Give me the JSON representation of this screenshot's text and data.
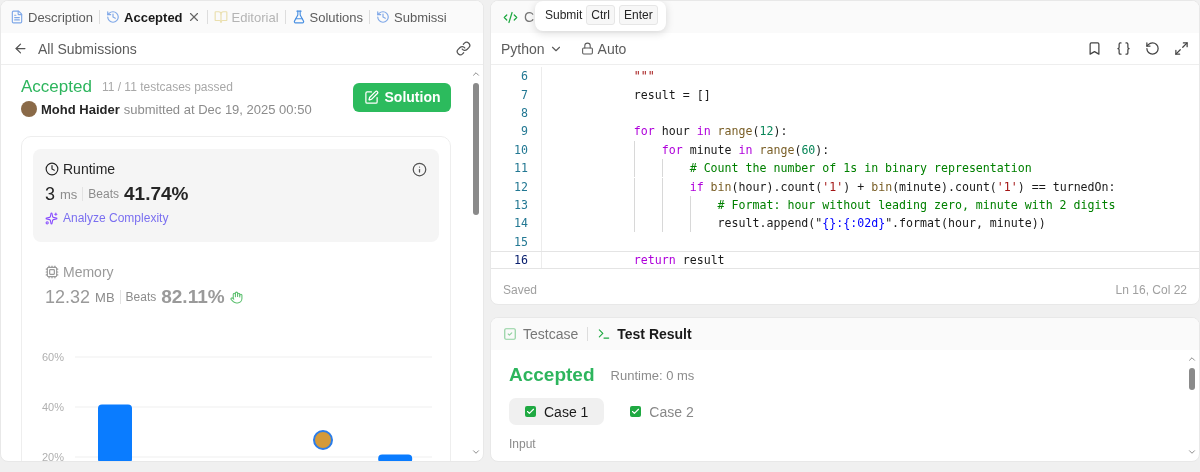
{
  "left_panel": {
    "tabs": [
      {
        "label": "Description",
        "selected": false,
        "disabled": false,
        "closable": false
      },
      {
        "label": "Accepted",
        "selected": true,
        "disabled": false,
        "closable": true
      },
      {
        "label": "Editorial",
        "selected": false,
        "disabled": true,
        "closable": false
      },
      {
        "label": "Solutions",
        "selected": false,
        "disabled": false,
        "closable": false
      },
      {
        "label": "Submissi",
        "selected": false,
        "disabled": false,
        "closable": false
      }
    ],
    "back_label": "All Submissions",
    "submission": {
      "status": "Accepted",
      "testcases": "11 / 11 testcases passed",
      "author": "Mohd Haider",
      "submitted": "submitted at Dec 19, 2025 00:50",
      "solution_button": "Solution"
    },
    "metrics": [
      {
        "title": "Runtime",
        "value": "3",
        "unit": "ms",
        "beats_label": "Beats",
        "beats": "41.74%",
        "analyze": "Analyze Complexity",
        "selected": true
      },
      {
        "title": "Memory",
        "value": "12.32",
        "unit": "MB",
        "beats_label": "Beats",
        "beats": "82.11%",
        "selected": false
      }
    ],
    "chart_data": {
      "type": "bar",
      "grid": true,
      "ylim": [
        20,
        60
      ],
      "yticks": [
        {
          "value": 20,
          "label": "20%"
        },
        {
          "value": 40,
          "label": "40%"
        },
        {
          "value": 60,
          "label": "60%"
        }
      ],
      "values": [
        41,
        null,
        null,
        null,
        null,
        null,
        21
      ]
    }
  },
  "editor": {
    "tab": {
      "label": "C"
    },
    "tooltip": {
      "label": "Submit",
      "keys": [
        "Ctrl",
        "Enter"
      ]
    },
    "language": "Python",
    "mode": "Auto",
    "lines": [
      {
        "number": "6",
        "current": false,
        "tokens": [
          {
            "t": "        \"\"\"",
            "kind": "string"
          }
        ]
      },
      {
        "number": "7",
        "current": false,
        "tokens": [
          {
            "t": "        result = []",
            "kind": "plain"
          }
        ]
      },
      {
        "number": "8",
        "current": false
      },
      {
        "number": "9",
        "current": false,
        "tokens": [
          {
            "t": "        for",
            "kind": "keyword"
          },
          {
            "t": " hour ",
            "kind": "plain"
          },
          {
            "t": "in",
            "kind": "keyword"
          },
          {
            "t": " range",
            "kind": "builtin"
          },
          {
            "t": "(",
            "kind": "plain"
          },
          {
            "t": "12",
            "kind": "number"
          },
          {
            "t": "):",
            "kind": "plain"
          }
        ]
      },
      {
        "number": "10",
        "current": false,
        "tokens": [
          {
            "t": "            for",
            "kind": "keyword"
          },
          {
            "t": " minute ",
            "kind": "plain"
          },
          {
            "t": "in",
            "kind": "keyword"
          },
          {
            "t": " range",
            "kind": "builtin"
          },
          {
            "t": "(",
            "kind": "plain"
          },
          {
            "t": "60",
            "kind": "number"
          },
          {
            "t": "):",
            "kind": "plain"
          }
        ]
      },
      {
        "number": "11",
        "current": false,
        "tokens": [
          {
            "t": "                # Count the number of 1s in binary representation",
            "kind": "comment"
          }
        ]
      },
      {
        "number": "12",
        "current": false,
        "tokens": [
          {
            "t": "                if",
            "kind": "keyword"
          },
          {
            "t": " bin",
            "kind": "builtin"
          },
          {
            "t": "(hour).count(",
            "kind": "plain"
          },
          {
            "t": "'1'",
            "kind": "string"
          },
          {
            "t": ") + ",
            "kind": "plain"
          },
          {
            "t": "bin",
            "kind": "builtin"
          },
          {
            "t": "(minute).count(",
            "kind": "plain"
          },
          {
            "t": "'1'",
            "kind": "string"
          },
          {
            "t": ") == turnedOn:",
            "kind": "plain"
          }
        ]
      },
      {
        "number": "13",
        "current": false,
        "tokens": [
          {
            "t": "                    # Format: hour without leading zero, minute with 2 digits",
            "kind": "comment"
          }
        ]
      },
      {
        "number": "14",
        "current": false,
        "tokens": [
          {
            "t": "                    result.append(\"",
            "kind": "plain"
          },
          {
            "t": "{}:{:02d}",
            "kind": "format"
          },
          {
            "t": "\".format(hour, minute))",
            "kind": "plain"
          }
        ]
      },
      {
        "number": "15",
        "current": false
      },
      {
        "number": "16",
        "current": true,
        "tokens": [
          {
            "t": "        return",
            "kind": "keyword"
          },
          {
            "t": " result",
            "kind": "plain"
          }
        ]
      }
    ],
    "saved": "Saved",
    "position": "Ln 16, Col 22"
  },
  "console": {
    "tabs": [
      {
        "label": "Testcase",
        "selected": false
      },
      {
        "label": "Test Result",
        "selected": true
      }
    ],
    "status": "Accepted",
    "runtime": "Runtime: 0 ms",
    "cases": [
      {
        "label": "Case 1",
        "selected": true,
        "passed": true
      },
      {
        "label": "Case 2",
        "selected": false,
        "passed": true
      }
    ],
    "input_label": "Input"
  }
}
